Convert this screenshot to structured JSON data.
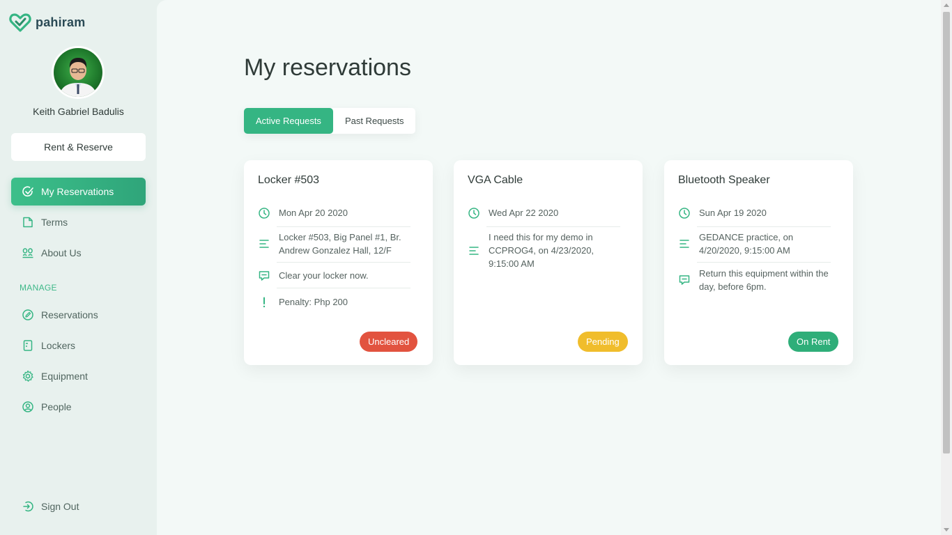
{
  "brand": {
    "name": "pahiram",
    "accent": "#35b583"
  },
  "user": {
    "name": "Keith Gabriel Badulis"
  },
  "sidebar": {
    "rent_button": "Rent & Reserve",
    "items": [
      {
        "label": "My Reservations",
        "icon": "check-circle-icon",
        "active": true
      },
      {
        "label": "Terms",
        "icon": "document-icon"
      },
      {
        "label": "About Us",
        "icon": "users-icon"
      }
    ],
    "manage_label": "MANAGE",
    "manage_items": [
      {
        "label": "Reservations",
        "icon": "pencil-circle-icon"
      },
      {
        "label": "Lockers",
        "icon": "locker-icon"
      },
      {
        "label": "Equipment",
        "icon": "gear-icon"
      },
      {
        "label": "People",
        "icon": "person-icon"
      }
    ],
    "sign_out": "Sign Out"
  },
  "main": {
    "title": "My reservations",
    "tabs": [
      {
        "label": "Active Requests",
        "active": true
      },
      {
        "label": "Past Requests",
        "active": false
      }
    ],
    "cards": [
      {
        "title": "Locker #503",
        "date": "Mon Apr 20 2020",
        "details": "Locker #503, Big Panel #1, Br. Andrew Gonzalez Hall, 12/F",
        "note": "Clear your locker now.",
        "penalty": "Penalty: Php 200",
        "status": "Uncleared",
        "status_color": "#e2533f"
      },
      {
        "title": "VGA Cable",
        "date": "Wed Apr 22 2020",
        "details": "I need this for my demo in CCPROG4, on 4/23/2020, 9:15:00 AM",
        "status": "Pending",
        "status_color": "#f0bd2c"
      },
      {
        "title": "Bluetooth Speaker",
        "date": "Sun Apr 19 2020",
        "details": "GEDANCE practice, on 4/20/2020, 9:15:00 AM",
        "note": "Return this equipment within the day, before 6pm.",
        "status": "On Rent",
        "status_color": "#2fae79"
      }
    ]
  }
}
